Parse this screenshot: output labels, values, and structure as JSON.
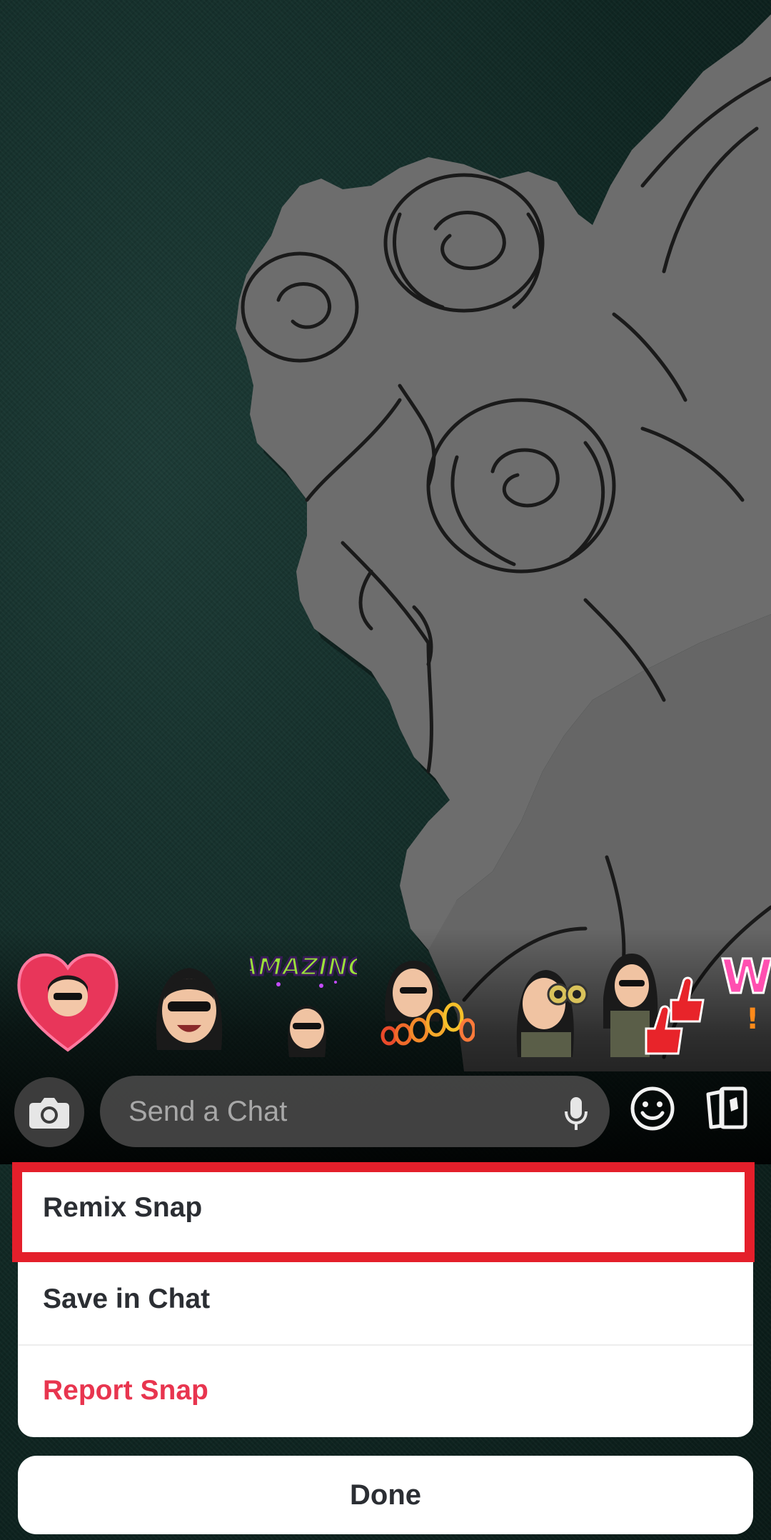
{
  "chat": {
    "placeholder": "Send a Chat"
  },
  "stickers": [
    {
      "name": "heart-bitmoji-sticker"
    },
    {
      "name": "smiling-bitmoji-sticker"
    },
    {
      "name": "amazing-bitmoji-sticker",
      "text": "AMAZING"
    },
    {
      "name": "ooo-bitmoji-sticker"
    },
    {
      "name": "binoculars-bitmoji-sticker"
    },
    {
      "name": "thumbs-up-bitmoji-sticker"
    },
    {
      "name": "wow-bitmoji-sticker",
      "text": "WO"
    }
  ],
  "menu": {
    "items": [
      {
        "label": "Remix Snap",
        "highlighted": true
      },
      {
        "label": "Save in Chat"
      },
      {
        "label": "Report Snap",
        "color": "#e8354f"
      }
    ]
  },
  "done_label": "Done",
  "colors": {
    "highlight": "#e41f2b",
    "danger": "#e8354f",
    "background": "#0f2622",
    "paper": "#6d6d6d"
  },
  "icons": [
    "camera-icon",
    "microphone-icon",
    "smiley-icon",
    "sticker-cards-icon"
  ]
}
